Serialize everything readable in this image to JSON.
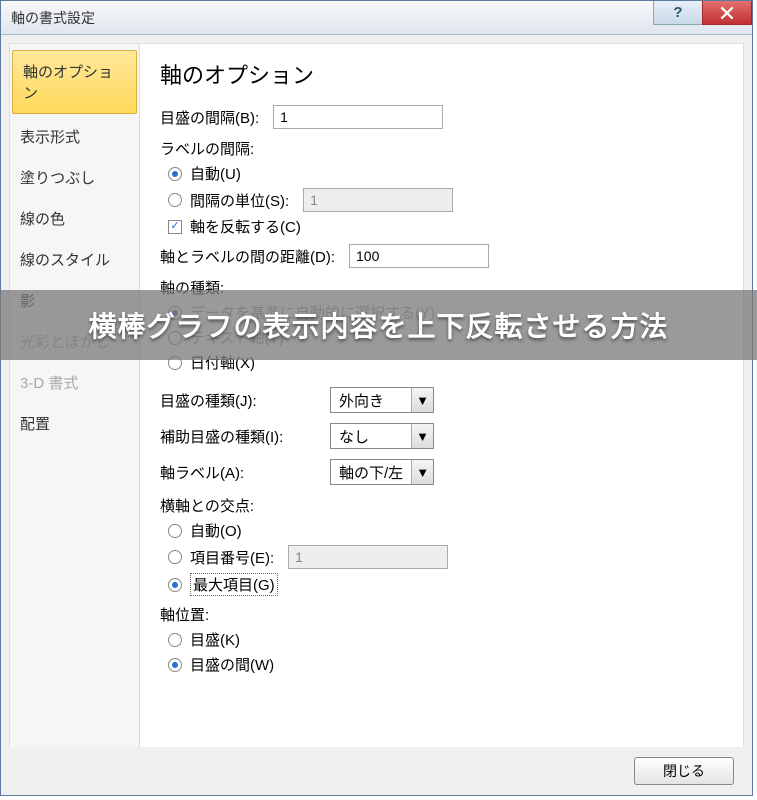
{
  "titlebar": {
    "title": "軸の書式設定"
  },
  "sidebar": {
    "items": [
      {
        "label": "軸のオプション",
        "selected": true
      },
      {
        "label": "表示形式"
      },
      {
        "label": "塗りつぶし"
      },
      {
        "label": "線の色"
      },
      {
        "label": "線のスタイル"
      },
      {
        "label": "影"
      },
      {
        "label": "光彩とぼかし",
        "disabled": true
      },
      {
        "label": "3-D 書式",
        "disabled": true
      },
      {
        "label": "配置"
      }
    ]
  },
  "main": {
    "heading": "軸のオプション",
    "interval_label": "目盛の間隔(B):",
    "interval_value": "1",
    "label_interval_heading": "ラベルの間隔:",
    "label_interval_auto": "自動(U)",
    "label_interval_unit": "間隔の単位(S):",
    "label_interval_unit_value": "1",
    "reverse_axis": "軸を反転する(C)",
    "axis_label_distance": "軸とラベルの間の距離(D):",
    "axis_label_distance_value": "100",
    "axis_type_heading": "軸の種類:",
    "axis_type_auto": "データを基準に自動的に選択する(Y)",
    "axis_type_text": "テキスト軸(T)",
    "axis_type_date": "日付軸(X)",
    "tick_type_label": "目盛の種類(J):",
    "tick_type_value": "外向き",
    "minor_tick_label": "補助目盛の種類(I):",
    "minor_tick_value": "なし",
    "axis_label_label": "軸ラベル(A):",
    "axis_label_value": "軸の下/左",
    "cross_heading": "横軸との交点:",
    "cross_auto": "自動(O)",
    "cross_category": "項目番号(E):",
    "cross_category_value": "1",
    "cross_max": "最大項目(G)",
    "axis_pos_heading": "軸位置:",
    "axis_pos_on": "目盛(K)",
    "axis_pos_between": "目盛の間(W)"
  },
  "footer": {
    "close": "閉じる"
  },
  "overlay": {
    "text": "横棒グラフの表示内容を上下反転させる方法"
  }
}
